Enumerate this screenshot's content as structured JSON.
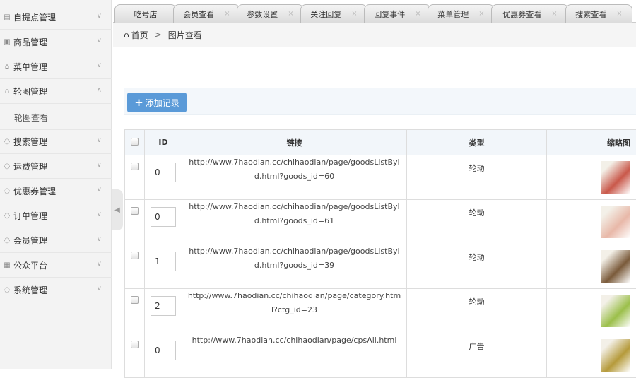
{
  "sidebar": {
    "items": [
      {
        "label": "自提点管理",
        "icon": "folder-icon",
        "chev": "∨"
      },
      {
        "label": "商品管理",
        "icon": "image-icon",
        "chev": "∨"
      },
      {
        "label": "菜单管理",
        "icon": "bag-icon",
        "chev": "∨"
      },
      {
        "label": "轮图管理",
        "icon": "bag-icon",
        "chev": "∧"
      },
      {
        "label": "轮图查看",
        "sub": true
      },
      {
        "label": "搜索管理",
        "icon": "chat-icon",
        "chev": "∨"
      },
      {
        "label": "运费管理",
        "icon": "chat-icon",
        "chev": "∨"
      },
      {
        "label": "优惠券管理",
        "icon": "chat-icon",
        "chev": "∨"
      },
      {
        "label": "订单管理",
        "icon": "chat-icon",
        "chev": "∨"
      },
      {
        "label": "会员管理",
        "icon": "chat-icon",
        "chev": "∨"
      },
      {
        "label": "公众平台",
        "icon": "building-icon",
        "chev": "∨"
      },
      {
        "label": "系统管理",
        "icon": "chat-icon",
        "chev": "∨"
      }
    ]
  },
  "tabs": [
    {
      "label": "吃号店"
    },
    {
      "label": "会员查看"
    },
    {
      "label": "参数设置"
    },
    {
      "label": "关注回复"
    },
    {
      "label": "回复事件"
    },
    {
      "label": "菜单管理"
    },
    {
      "label": "优惠券查看"
    },
    {
      "label": "搜索查看"
    }
  ],
  "breadcrumb": {
    "home": "首页",
    "sep": ">",
    "current": "图片查看"
  },
  "toolbar": {
    "add_label": "添加记录"
  },
  "table": {
    "headers": [
      "ID",
      "链接",
      "类型",
      "缩略图"
    ],
    "rows": [
      {
        "id": "0",
        "link": "http://www.7haodian.cc/chihaodian/page/goodsListById.html?goods_id=60",
        "type": "轮动",
        "thumb_color": "#c9584a"
      },
      {
        "id": "0",
        "link": "http://www.7haodian.cc/chihaodian/page/goodsListById.html?goods_id=61",
        "type": "轮动",
        "thumb_color": "#e8b8a8"
      },
      {
        "id": "1",
        "link": "http://www.7haodian.cc/chihaodian/page/goodsListById.html?goods_id=39",
        "type": "轮动",
        "thumb_color": "#7a5a3a"
      },
      {
        "id": "2",
        "link": "http://www.7haodian.cc/chihaodian/page/category.html?ctg_id=23",
        "type": "轮动",
        "thumb_color": "#9bbf4a"
      },
      {
        "id": "0",
        "link": "http://www.7haodian.cc/chihaodian/page/cpsAll.html",
        "type": "广告",
        "thumb_color": "#b59a3a"
      }
    ]
  }
}
